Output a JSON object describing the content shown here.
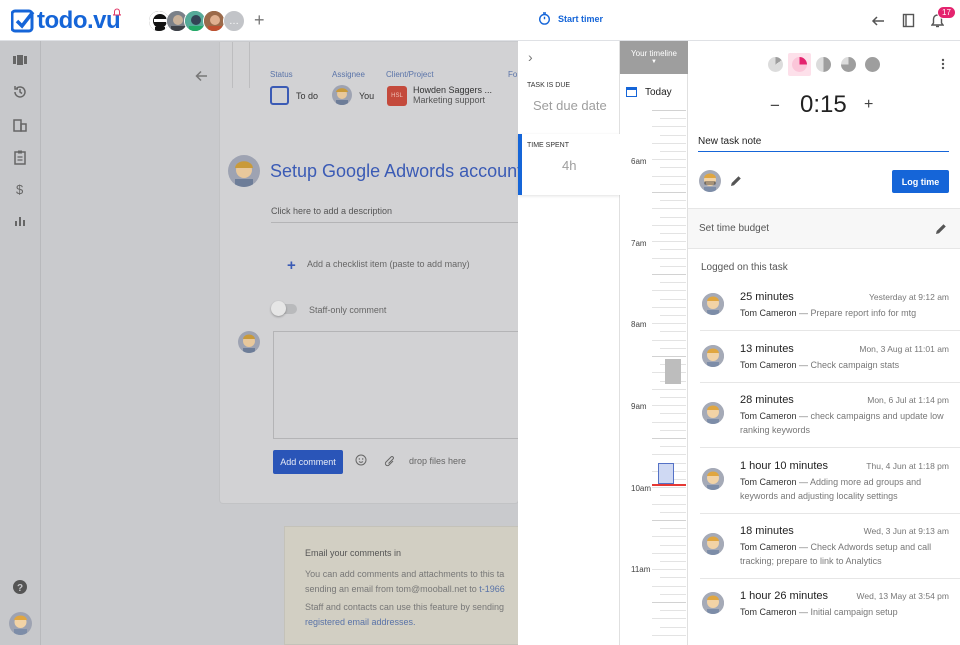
{
  "app": {
    "logo_text": "todo.vu"
  },
  "topbar": {
    "add_member": "+",
    "more_avatars": "…",
    "start_timer_label": "Start timer",
    "notifications_count": "17"
  },
  "task": {
    "status_label": "Status",
    "status_value": "To do",
    "assignee_label": "Assignee",
    "assignee_value": "You",
    "client_label": "Client/Project",
    "client_badge": "HSL",
    "client_name": "Howden Saggers ...",
    "client_project": "Marketing support",
    "extra_label": "Fo",
    "title": "Setup Google Adwords account ar",
    "description_placeholder": "Click here to add a description",
    "checklist_label": "Add a checklist item (paste to add many)",
    "staff_only_label": "Staff-only comment",
    "add_comment_label": "Add comment",
    "drop_files_label": "drop files here"
  },
  "email_box": {
    "title": "Email your comments in",
    "line1": "You can add comments and attachments to this ta",
    "line2_prefix": "sending an email from tom@mooball.net to ",
    "line2_link": "t-1966",
    "line3": "Staff and contacts can use this feature by sending",
    "line4_link": "registered email addresses."
  },
  "task_panel": {
    "collapse": "›",
    "due_label": "TASK IS DUE",
    "due_value": "Set due date",
    "spent_label": "TIME SPENT",
    "spent_value": "4h"
  },
  "timeline": {
    "header": "Your timeline",
    "today_label": "Today",
    "hours": [
      "6am",
      "7am",
      "8am",
      "9am",
      "10am",
      "11am"
    ]
  },
  "timer": {
    "minus": "−",
    "value": "0:15",
    "plus": "+",
    "note_value": "New task note",
    "log_time_label": "Log time",
    "budget_label": "Set time budget",
    "logged_heading": "Logged on this task"
  },
  "entries": [
    {
      "duration": "25 minutes",
      "when": "Yesterday at 9:12 am",
      "user": "Tom Cameron",
      "note": "Prepare report info for mtg"
    },
    {
      "duration": "13 minutes",
      "when": "Mon, 3 Aug at 11:01 am",
      "user": "Tom Cameron",
      "note": "Check campaign stats"
    },
    {
      "duration": "28 minutes",
      "when": "Mon, 6 Jul at 1:14 pm",
      "user": "Tom Cameron",
      "note": "check campaigns and update low ranking keywords"
    },
    {
      "duration": "1 hour 10 minutes",
      "when": "Thu, 4 Jun at 1:18 pm",
      "user": "Tom Cameron",
      "note": "Adding more ad groups and keywords and adjusting locality settings"
    },
    {
      "duration": "18 minutes",
      "when": "Wed, 3 Jun at 9:13 am",
      "user": "Tom Cameron",
      "note": "Check Adwords setup and call tracking; prepare to link to Analytics"
    },
    {
      "duration": "1 hour 26 minutes",
      "when": "Wed, 13 May at 3:54 pm",
      "user": "Tom Cameron",
      "note": "Initial campaign setup"
    }
  ],
  "colors": {
    "accent": "#1565d8",
    "notification": "#e4236e",
    "active_pie": "#e4236e"
  }
}
